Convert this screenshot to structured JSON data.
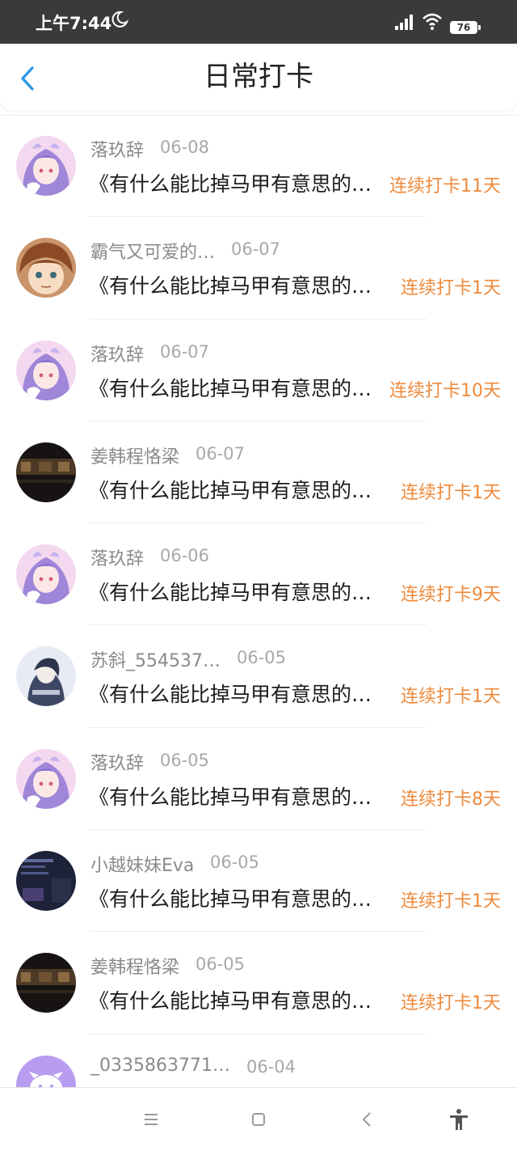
{
  "status_bar": {
    "time": "上午7:44",
    "battery": "76"
  },
  "header": {
    "title": "日常打卡"
  },
  "entries": [
    {
      "name": "落玖辞",
      "date": "06-08",
      "content": "《有什么能比掉马甲有意思的事情",
      "streak": "连续打卡11天",
      "avatar": "anime-girl-avatar"
    },
    {
      "name": "霸气又可爱的…",
      "date": "06-07",
      "content": "《有什么能比掉马甲有意思的事情",
      "streak": "连续打卡1天",
      "avatar": "anime-boy-avatar"
    },
    {
      "name": "落玖辞",
      "date": "06-07",
      "content": "《有什么能比掉马甲有意思的事情",
      "streak": "连续打卡10天",
      "avatar": "anime-girl-avatar"
    },
    {
      "name": "姜韩程恪梁",
      "date": "06-07",
      "content": "《有什么能比掉马甲有意思的事情",
      "streak": "连续打卡1天",
      "avatar": "dark-scene-avatar"
    },
    {
      "name": "落玖辞",
      "date": "06-06",
      "content": "《有什么能比掉马甲有意思的事情",
      "streak": "连续打卡9天",
      "avatar": "anime-girl-avatar"
    },
    {
      "name": "苏斜_554537…",
      "date": "06-05",
      "content": "《有什么能比掉马甲有意思的事情",
      "streak": "连续打卡1天",
      "avatar": "pale-figure-avatar"
    },
    {
      "name": "落玖辞",
      "date": "06-05",
      "content": "《有什么能比掉马甲有意思的事情",
      "streak": "连续打卡8天",
      "avatar": "anime-girl-avatar"
    },
    {
      "name": "小越妹妹Eva",
      "date": "06-05",
      "content": "《有什么能比掉马甲有意思的事情",
      "streak": "连续打卡1天",
      "avatar": "game-screen-avatar"
    },
    {
      "name": "姜韩程恪梁",
      "date": "06-05",
      "content": "《有什么能比掉马甲有意思的事情",
      "streak": "连续打卡1天",
      "avatar": "dark-scene-avatar"
    },
    {
      "name": "_0335863771…",
      "date": "06-04",
      "content": "",
      "streak": "",
      "avatar": "default-face-avatar"
    }
  ],
  "nav": {
    "items": [
      "menu-icon",
      "home-icon",
      "back-icon",
      "accessibility-icon"
    ]
  },
  "colors": {
    "accent": "#ee8a3c",
    "back": "#2f98e6",
    "status_bar": "#3a3a3a"
  }
}
